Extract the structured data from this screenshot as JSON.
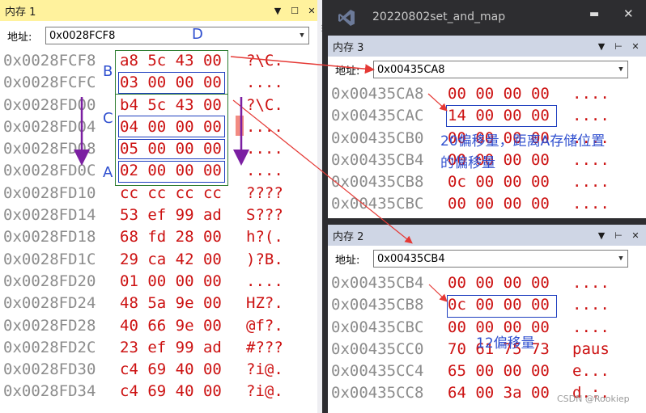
{
  "left_pane": {
    "title": "内存 1",
    "address_label": "地址:",
    "address_value": "0x0028FCF8",
    "rows": [
      {
        "addr": "0x0028FCF8",
        "hex": "a8 5c 43 00",
        "ascii": "?\\C."
      },
      {
        "addr": "0x0028FCFC",
        "hex": "03 00 00 00",
        "ascii": "...."
      },
      {
        "addr": "0x0028FD00",
        "hex": "b4 5c 43 00",
        "ascii": "?\\C."
      },
      {
        "addr": "0x0028FD04",
        "hex": "04 00 00 00",
        "ascii": "...."
      },
      {
        "addr": "0x0028FD08",
        "hex": "05 00 00 00",
        "ascii": "...."
      },
      {
        "addr": "0x0028FD0C",
        "hex": "02 00 00 00",
        "ascii": "...."
      },
      {
        "addr": "0x0028FD10",
        "hex": "cc cc cc cc",
        "ascii": "????"
      },
      {
        "addr": "0x0028FD14",
        "hex": "53 ef 99 ad",
        "ascii": "S???"
      },
      {
        "addr": "0x0028FD18",
        "hex": "68 fd 28 00",
        "ascii": "h?(."
      },
      {
        "addr": "0x0028FD1C",
        "hex": "29 ca 42 00",
        "ascii": ")?B."
      },
      {
        "addr": "0x0028FD20",
        "hex": "01 00 00 00",
        "ascii": "...."
      },
      {
        "addr": "0x0028FD24",
        "hex": "48 5a 9e 00",
        "ascii": "HZ?."
      },
      {
        "addr": "0x0028FD28",
        "hex": "40 66 9e 00",
        "ascii": "@f?."
      },
      {
        "addr": "0x0028FD2C",
        "hex": "23 ef 99 ad",
        "ascii": "#???"
      },
      {
        "addr": "0x0028FD30",
        "hex": "c4 69 40 00",
        "ascii": "?i@."
      },
      {
        "addr": "0x0028FD34",
        "hex": "c4 69 40 00",
        "ascii": "?i@."
      }
    ]
  },
  "vs_window": {
    "title": "20220802set_and_map"
  },
  "pane3": {
    "title": "内存 3",
    "address_label": "地址:",
    "address_value": "0x00435CA8",
    "rows": [
      {
        "addr": "0x00435CA8",
        "hex": "00 00 00 00",
        "ascii": "...."
      },
      {
        "addr": "0x00435CAC",
        "hex": "14 00 00 00",
        "ascii": "...."
      },
      {
        "addr": "0x00435CB0",
        "hex": "00 00 00 00",
        "ascii": "...."
      },
      {
        "addr": "0x00435CB4",
        "hex": "00 00 00 00",
        "ascii": "...."
      },
      {
        "addr": "0x00435CB8",
        "hex": "0c 00 00 00",
        "ascii": "...."
      },
      {
        "addr": "0x00435CBC",
        "hex": "00 00 00 00",
        "ascii": "...."
      }
    ]
  },
  "pane2": {
    "title": "内存 2",
    "address_label": "地址:",
    "address_value": "0x00435CB4",
    "rows": [
      {
        "addr": "0x00435CB4",
        "hex": "00 00 00 00",
        "ascii": "...."
      },
      {
        "addr": "0x00435CB8",
        "hex": "0c 00 00 00",
        "ascii": "...."
      },
      {
        "addr": "0x00435CBC",
        "hex": "00 00 00 00",
        "ascii": "...."
      },
      {
        "addr": "0x00435CC0",
        "hex": "70 61 75 73",
        "ascii": "paus"
      },
      {
        "addr": "0x00435CC4",
        "hex": "65 00 00 00",
        "ascii": "e..."
      },
      {
        "addr": "0x00435CC8",
        "hex": "64 00 3a 00",
        "ascii": "d.:."
      }
    ]
  },
  "annotations": {
    "A": "A",
    "B": "B",
    "C": "C",
    "D": "D",
    "offset20_line1": "20偏移量，距离A存储位置",
    "offset20_line2": "的偏移量",
    "offset12": "12偏移量"
  },
  "watermark": "CSDN @Rookiep",
  "colors": {
    "title_active": "#fff29d",
    "title_inactive": "#cfd6e5",
    "hex_text": "#cc1111",
    "addr_text": "#8c8c8c",
    "annotation_blue": "#2f4fcf",
    "arrow_red": "#e53935",
    "arrow_purple": "#7b1fa2",
    "group_green": "#2e7d32",
    "vs_frame": "#2d2d30"
  }
}
